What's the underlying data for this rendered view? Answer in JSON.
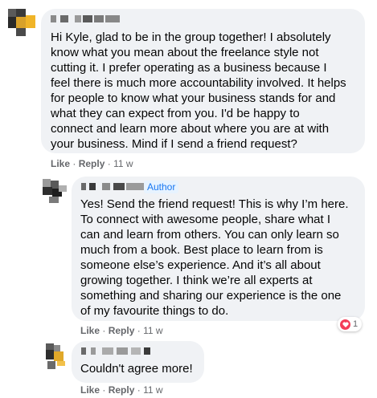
{
  "comments": [
    {
      "lines": [
        "Hi Kyle, glad to be in the group together! I absolutely",
        "know what you mean about the freelance style not",
        "cutting it. I prefer operating as a business because I",
        "feel there is much more accountability involved. It helps",
        "for people to know what your business stands for and",
        "what they can expect from you. I'd be happy to",
        "connect and learn more about where you are at with",
        "your business. Mind if I send a friend request?"
      ],
      "like": "Like",
      "sep": "·",
      "reply": "Reply",
      "time": "11 w"
    },
    {
      "badge": "Author",
      "lines": [
        "Yes! Send the friend request! This is why I’m here.",
        "To connect with awesome people, share what I",
        "can and learn from others. You can only learn so",
        "much from a book. Best place to learn from is",
        "someone else’s experience. And it’s all about",
        "growing together. I think we’re all experts at",
        "something and sharing our experience is the one",
        "of my favourite things to do."
      ],
      "like": "Like",
      "sep": "·",
      "reply": "Reply",
      "time": "11 w",
      "reaction_count": "1"
    },
    {
      "lines": [
        "Couldn't agree more!"
      ],
      "like": "Like",
      "sep": "·",
      "reply": "Reply",
      "time": "11 w"
    }
  ],
  "colors": {
    "bubble": "#f0f2f5",
    "secondary_text": "#65676b",
    "author_badge_bg": "#e7f3ff",
    "author_badge_text": "#1877f2",
    "heart": "#f33e58"
  },
  "icons": [
    "heart-reaction-icon"
  ]
}
